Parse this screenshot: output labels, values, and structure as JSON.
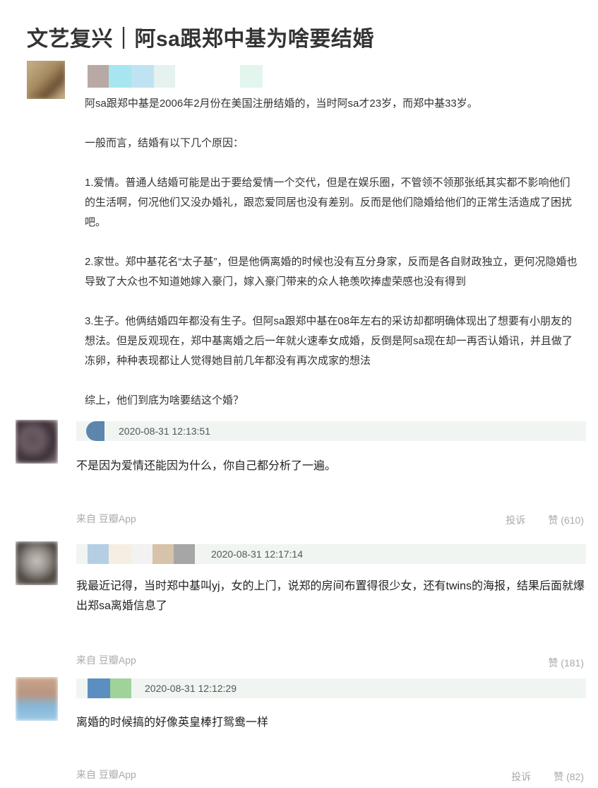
{
  "page": {
    "title": "文艺复兴｜阿sa跟郑中基为啥要结婚"
  },
  "post": {
    "paragraphs": [
      "阿sa跟郑中基是2006年2月份在美国注册结婚的，当时阿sa才23岁，而郑中基33岁。",
      "一般而言，结婚有以下几个原因：",
      "1.爱情。普通人结婚可能是出于要给爱情一个交代，但是在娱乐圈，不管领不领那张纸其实都不影响他们的生活啊，何况他们又没办婚礼，跟恋爱同居也没有差别。反而是他们隐婚给他们的正常生活造成了困扰吧。",
      "2.家世。郑中基花名“太子基”，但是他俩离婚的时候也没有互分身家，反而是各自财政独立，更何况隐婚也导致了大众也不知道她嫁入豪门，嫁入豪门带来的众人艳羡吹捧虚荣感也没有得到",
      "3.生子。他俩结婚四年都没有生子。但阿sa跟郑中基在08年左右的采访却都明确体现出了想要有小朋友的想法。但是反观现在，郑中基离婚之后一年就火速奉女成婚，反倒是阿sa现在却一再否认婚讯，并且做了冻卵，种种表现都让人觉得她目前几年都没有再次成家的想法",
      "综上，他们到底为啥要结这个婚？"
    ]
  },
  "comments": [
    {
      "time": "2020-08-31 12:13:51",
      "text": "不是因为爱情还能因为什么，你自己都分析了一遍。",
      "from": "来自 豆瓣App",
      "report": "投诉",
      "likes": "赞 (610)"
    },
    {
      "time": "2020-08-31 12:17:14",
      "text": "我最近记得，当时郑中基叫yj，女的上门，说郑的房间布置得很少女，还有twins的海报，结果后面就爆出郑sa离婚信息了",
      "from": "来自 豆瓣App",
      "likes": "赞 (181)"
    },
    {
      "time": "2020-08-31 12:12:29",
      "text": "离婚的时候搞的好像英皇棒打鸳鸯一样",
      "from": "来自 豆瓣App",
      "report": "投诉",
      "likes": "赞 (82)"
    }
  ]
}
